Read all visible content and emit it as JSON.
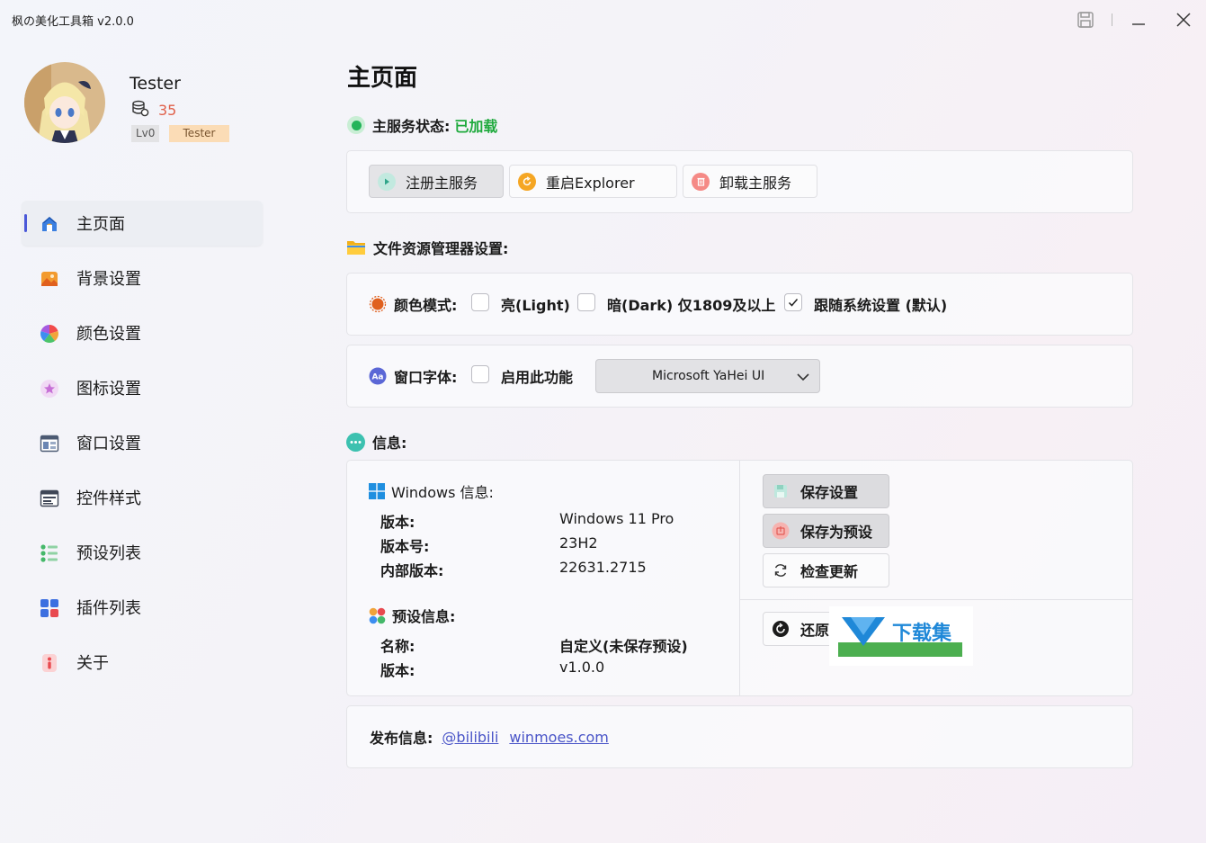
{
  "window": {
    "title": "枫の美化工具箱 v2.0.0",
    "icons": [
      "save-icon",
      "minimize-icon",
      "close-icon"
    ]
  },
  "user": {
    "name": "Tester",
    "coins": "35",
    "level": "Lv0",
    "tag": "Tester"
  },
  "sidebar": {
    "items": [
      {
        "label": "主页面",
        "icon": "home-icon",
        "active": true
      },
      {
        "label": "背景设置",
        "icon": "image-icon"
      },
      {
        "label": "颜色设置",
        "icon": "color-wheel-icon"
      },
      {
        "label": "图标设置",
        "icon": "star-badge-icon"
      },
      {
        "label": "窗口设置",
        "icon": "window-layout-icon"
      },
      {
        "label": "控件样式",
        "icon": "controls-icon"
      },
      {
        "label": "预设列表",
        "icon": "list-icon"
      },
      {
        "label": "插件列表",
        "icon": "apps-grid-icon"
      },
      {
        "label": "关于",
        "icon": "info-icon"
      }
    ]
  },
  "main": {
    "title": "主页面",
    "status_label": "主服务状态:",
    "status_value": "已加载",
    "service_buttons": {
      "register": "注册主服务",
      "restart": "重启Explorer",
      "uninstall": "卸载主服务"
    },
    "explorer_section": "文件资源管理器设置:",
    "color_mode": {
      "label": "颜色模式:",
      "options": [
        {
          "label": "亮(Light)",
          "checked": false
        },
        {
          "label": "暗(Dark) 仅1809及以上",
          "checked": false
        },
        {
          "label": "跟随系统设置 (默认)",
          "checked": true
        }
      ]
    },
    "window_font": {
      "label": "窗口字体:",
      "enable_label": "启用此功能",
      "enabled": false,
      "selected_font": "Microsoft YaHei UI"
    },
    "info_section": "信息:",
    "windows_info": {
      "header": "Windows 信息:",
      "rows": [
        {
          "key": "版本:",
          "value": "Windows 11 Pro"
        },
        {
          "key": "版本号:",
          "value": "23H2"
        },
        {
          "key": "内部版本:",
          "value": "22631.2715"
        }
      ]
    },
    "preset_info": {
      "header": "预设信息:",
      "rows": [
        {
          "key": "名称:",
          "value": "自定义(未保存预设)"
        },
        {
          "key": "版本:",
          "value": "v1.0.0"
        }
      ]
    },
    "actions": {
      "save_settings": "保存设置",
      "save_as_preset": "保存为预设",
      "check_update": "检查更新",
      "restore": "还原"
    },
    "release": {
      "label": "发布信息:",
      "links": [
        "@bilibili",
        "winmoes.com"
      ]
    }
  },
  "watermark": {
    "text": "下载集"
  },
  "colors": {
    "accent": "#4a58d8",
    "status_green": "#1faa3d",
    "coin_orange": "#e0604a",
    "link": "#4a55c8"
  }
}
